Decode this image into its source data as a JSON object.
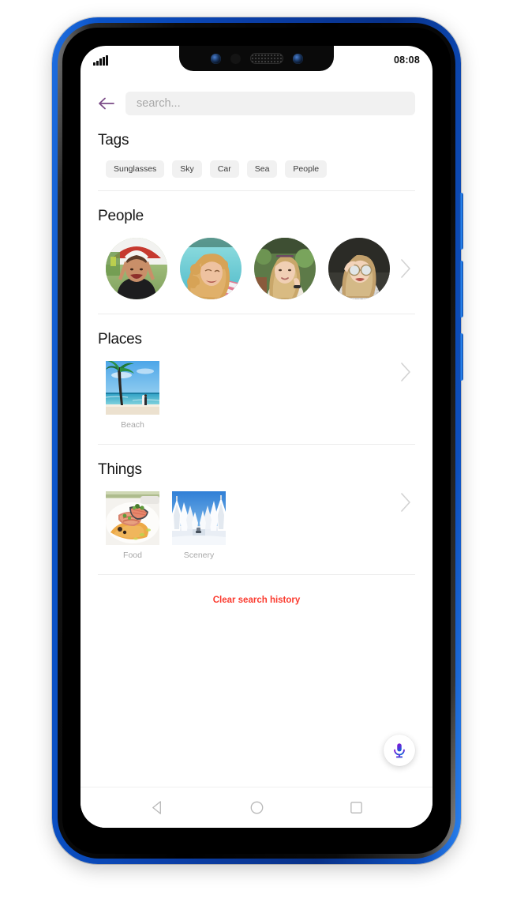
{
  "status_bar": {
    "signal_icon": "signal-bars-icon",
    "time": "08:08"
  },
  "search": {
    "back_icon": "back-arrow-icon",
    "placeholder": "search...",
    "value": ""
  },
  "sections": {
    "tags": {
      "title": "Tags",
      "chips": [
        "Sunglasses",
        "Sky",
        "Car",
        "Sea",
        "People"
      ]
    },
    "people": {
      "title": "People",
      "chevron_icon": "chevron-right-icon",
      "faces": [
        "woman-laughing-red-umbrella",
        "woman-curly-blonde-turquoise",
        "woman-blonde-hand-on-face",
        "woman-round-sunglasses"
      ]
    },
    "places": {
      "title": "Places",
      "chevron_icon": "chevron-right-icon",
      "tiles": [
        {
          "label": "Beach",
          "image": "palm-tree-beach-surfer"
        }
      ]
    },
    "things": {
      "title": "Things",
      "chevron_icon": "chevron-right-icon",
      "tiles": [
        {
          "label": "Food",
          "image": "plated-salmon-dish"
        },
        {
          "label": "Scenery",
          "image": "snowy-forest-road"
        }
      ]
    }
  },
  "clear_history": {
    "label": "Clear search history"
  },
  "mic_fab": {
    "icon": "microphone-icon"
  },
  "nav_bar": {
    "back_icon": "nav-back-triangle-icon",
    "home_icon": "nav-home-circle-icon",
    "recents_icon": "nav-recents-square-icon"
  },
  "colors": {
    "accent_back_arrow": "#7a4a86",
    "clear_history_red": "#fb3a2e",
    "chip_background": "#f1f1f1",
    "search_background": "#f1f1f1",
    "label_gray": "#a8a8a8",
    "frame_blue": "#0b3fa8",
    "mic_gradient_start": "#7b1fd4",
    "mic_gradient_end": "#1060d8"
  }
}
